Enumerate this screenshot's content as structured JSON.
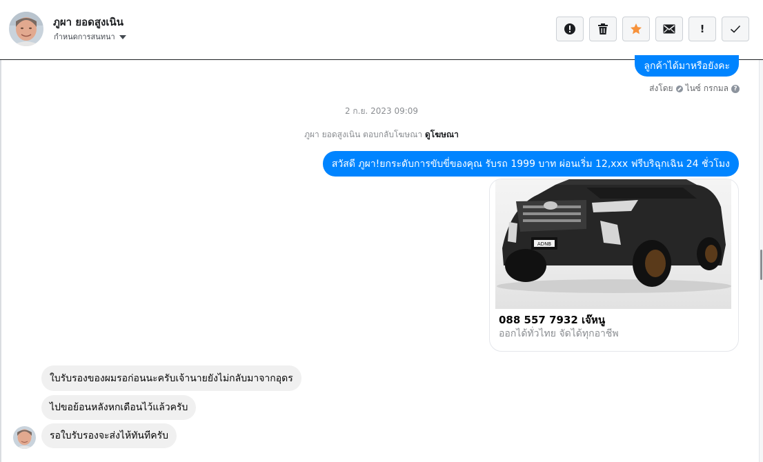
{
  "header": {
    "contact_name": "ภูผา ยอดสูงเนิน",
    "subtitle": "กำหนดการสนทนา",
    "actions": [
      {
        "name": "report-icon",
        "label": "!"
      },
      {
        "name": "trash-icon"
      },
      {
        "name": "star-icon"
      },
      {
        "name": "envelope-icon"
      },
      {
        "name": "spam-icon",
        "label": "!"
      },
      {
        "name": "check-icon"
      }
    ]
  },
  "colors": {
    "accent_blue": "#0084ff",
    "star_orange": "#f7923b",
    "incoming_bubble": "#f0f0f0"
  },
  "conversation": {
    "top_outgoing": "ลูกค้าได้มาหรือยังคะ",
    "sent_by_prefix": "ส่งโดย",
    "sent_by_name": "ไนซ์ กรกมล",
    "timestamp": "2 ก.ย. 2023 09:09",
    "reply_note_prefix": "ภูผา ยอดสูงเนิน ตอบกลับโฆษณา",
    "reply_note_link": "ดูโฆษณา",
    "ad_message": "สวัสดี ภูผา!ยกระดับการขับขี่ของคุณ รับรถ 1999 บาท  ผ่อนเริ่ม 12,xxx ฟรีบริฉุกเฉิน 24 ชั่วโมง",
    "ad_card": {
      "title": "088 557 7932 เจ๊หนู",
      "description": "ออกได้ทั่วไทย จัดได้ทุกอาชีพ",
      "plate_text": "ADNB"
    },
    "incoming": [
      "ใบรับรองของผมรอก่อนนะครับเจ้านายยังไม่กลับมาจากอุดร",
      "ไปขอย้อนหลังหกเดือนไว้แล้วครับ",
      "รอใบรับรองจะส่งไห้ทันทีครับ"
    ]
  }
}
